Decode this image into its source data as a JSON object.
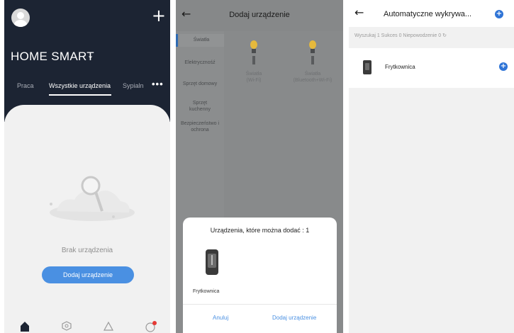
{
  "panel1": {
    "title": "HOME SMART",
    "tabs": [
      "Praca",
      "Wszystkie urządzenia",
      "Sypialn"
    ],
    "empty_text": "Brak urządzenia",
    "add_button": "Dodaj urządzenie",
    "nav_icons": [
      "home-icon",
      "scene-icon",
      "smart-icon",
      "profile-icon"
    ]
  },
  "panel2": {
    "title": "Dodaj urządzenie",
    "categories": [
      "Światła",
      "Elektrycznośź",
      "Sprzęt domowy",
      "Sprzęt kuchenny",
      "Bezpieczeństwo i ochrona"
    ],
    "devices": [
      {
        "name": "Światła",
        "sub": "(Wi-Fi)"
      },
      {
        "name": "Światła",
        "sub": "(Bluetooth+Wi-Fi)"
      }
    ],
    "sheet": {
      "title": "Urządzenia, które można dodać : 1",
      "device_name": "Frytkownica",
      "cancel": "Anuluj",
      "add": "Dodaj urządzenie"
    }
  },
  "panel3": {
    "title": "Automatyczne wykrywa...",
    "status": "Wyszukaj 1  Sukces 0  Niepowodzenie 0",
    "device_name": "Frytkownica"
  },
  "colors": {
    "dark_header": "#1c2433",
    "accent": "#4a90e2",
    "add_blue": "#2f74d6",
    "bulb_yellow": "#e6b93c"
  }
}
